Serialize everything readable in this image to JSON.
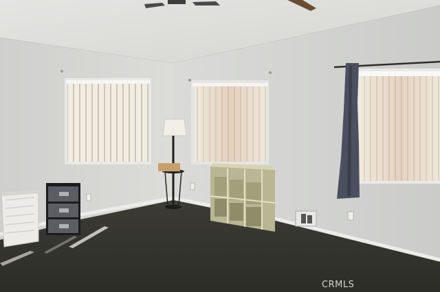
{
  "watermark": {
    "text": "CRMLS"
  },
  "colors": {
    "wall": "#d8d9d6",
    "ceiling": "#e6e7e4",
    "carpet": "#35352f",
    "curtain": "#4a4f5e",
    "blind": "#e9e2d2"
  },
  "objects": [
    "ceiling-fan",
    "left-window-blinds",
    "center-window-blinds",
    "right-window-blinds",
    "dark-curtain-panel",
    "floor-lamp",
    "white-laundry-hamper",
    "plastic-drawer-unit",
    "cube-shelf-organizer",
    "floor-vent",
    "carpet-floor"
  ]
}
